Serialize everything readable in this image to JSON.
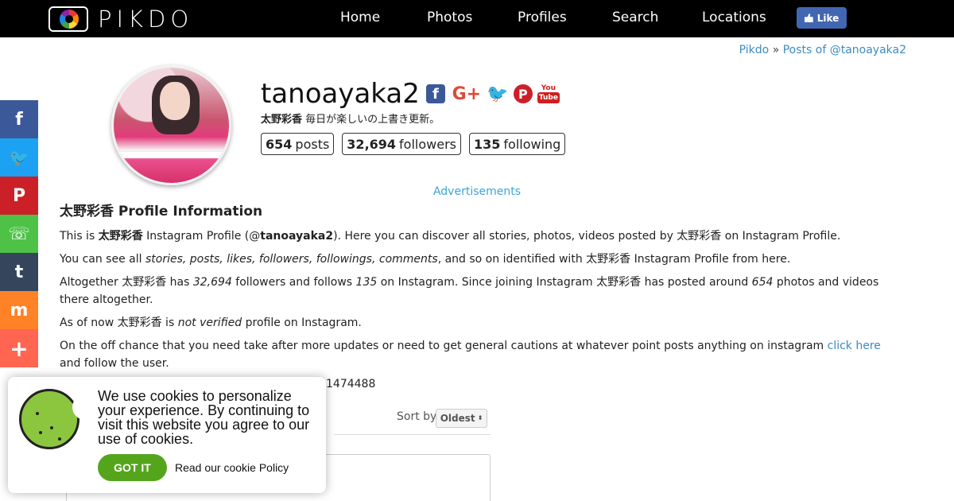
{
  "site": {
    "name": "PIKDO"
  },
  "nav": [
    {
      "label": "Home",
      "key": "home"
    },
    {
      "label": "Photos",
      "key": "photos"
    },
    {
      "label": "Profiles",
      "key": "profiles"
    },
    {
      "label": "Search",
      "key": "search"
    },
    {
      "label": "Locations",
      "key": "locations"
    }
  ],
  "fb_like_label": "Like",
  "breadcrumb": {
    "home": "Pikdo",
    "sep": "»",
    "current": "Posts of @tanoayaka2"
  },
  "profile": {
    "username": "tanoayaka2",
    "display_name": "太野彩香",
    "bio": "毎日が楽しいの上書き更新。",
    "stats": [
      {
        "value": "654",
        "label": "posts"
      },
      {
        "value": "32,694",
        "label": "followers"
      },
      {
        "value": "135",
        "label": "following"
      }
    ]
  },
  "social_icons": [
    "facebook-icon",
    "google-plus-icon",
    "twitter-icon",
    "pinterest-icon",
    "youtube-icon"
  ],
  "share_sidebar": [
    {
      "name": "facebook",
      "glyph": "f",
      "color": "#3b5998"
    },
    {
      "name": "twitter",
      "glyph": "🐦",
      "color": "#1da1f2"
    },
    {
      "name": "pinterest",
      "glyph": "P",
      "color": "#cb2027"
    },
    {
      "name": "whatsapp",
      "glyph": "☏",
      "color": "#4dc247"
    },
    {
      "name": "tumblr",
      "glyph": "t",
      "color": "#35465c"
    },
    {
      "name": "mix",
      "glyph": "m",
      "color": "#ff8226"
    },
    {
      "name": "more",
      "glyph": "+",
      "color": "#ff6550"
    }
  ],
  "ads_label": "Advertisements",
  "info": {
    "heading": "太野彩香 Profile Information",
    "p1": {
      "a": "This is ",
      "name": "太野彩香",
      "b": " Instagram Profile (@",
      "user": "tanoayaka2",
      "c": "). Here you can discover all stories, photos, videos posted by 太野彩香 on Instagram Profile."
    },
    "p2": {
      "a": "You can see all ",
      "list": "stories, posts, likes, followers, followings, comments",
      "b": ", and so on identified with 太野彩香 Instagram Profile from here."
    },
    "p3": {
      "a": "Altogether 太野彩香 has ",
      "followers": "32,694",
      "b": " followers and follows ",
      "following": "135",
      "c": " on Instagram. Since joining Instagram 太野彩香 has posted around ",
      "posts": "654",
      "d": " photos and videos there altogether."
    },
    "p4": {
      "a": "As of now 太野彩香 is ",
      "status": "not verified",
      "b": " profile on Instagram."
    },
    "p5": {
      "a": "On the off chance that you need take after more updates or need to get general cautions at whatever point posts anything on instagram ",
      "link": "click here",
      "b": " and follow the user."
    }
  },
  "id_tail": "1474488",
  "sort": {
    "label": "Sort by",
    "value": "Oldest"
  },
  "cookie": {
    "text": "We use cookies to personalize your experience. By continuing to visit this website you agree to our use of cookies.",
    "button": "GOT IT",
    "policy": "Read our cookie Policy"
  }
}
